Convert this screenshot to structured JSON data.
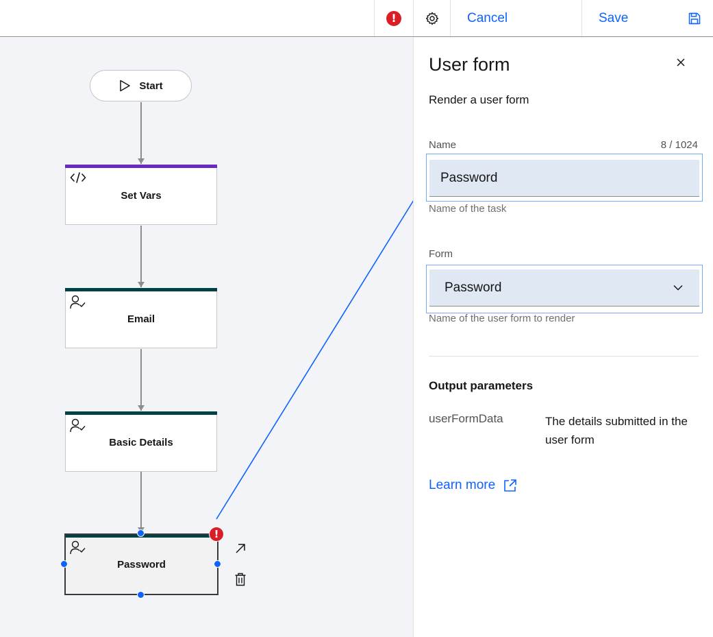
{
  "toolbar": {
    "cancel_label": "Cancel",
    "save_label": "Save",
    "error_symbol": "!"
  },
  "canvas": {
    "start_label": "Start",
    "nodes": [
      {
        "label": "Set Vars",
        "icon": "code-icon",
        "bar_color": "#6929c4"
      },
      {
        "label": "Email",
        "icon": "user-task-icon",
        "bar_color": "#004144"
      },
      {
        "label": "Basic Details",
        "icon": "user-task-icon",
        "bar_color": "#004144"
      },
      {
        "label": "Password",
        "icon": "user-task-icon",
        "bar_color": "#004144",
        "selected": true,
        "has_error": true
      }
    ],
    "error_symbol": "!"
  },
  "panel": {
    "title": "User form",
    "description": "Render a user form",
    "name_field": {
      "label": "Name",
      "counter": "8 / 1024",
      "value": "Password",
      "helper": "Name of the task"
    },
    "form_field": {
      "label": "Form",
      "value": "Password",
      "helper": "Name of the user form to render"
    },
    "output": {
      "title": "Output parameters",
      "param_name": "userFormData",
      "param_desc": "The details submitted in the user form"
    },
    "learn_more": "Learn more"
  },
  "colors": {
    "accent": "#0f62fe",
    "error": "#da1e28",
    "purple_bar": "#6929c4",
    "teal_bar": "#004144",
    "field_bg": "#dfe8f3"
  }
}
